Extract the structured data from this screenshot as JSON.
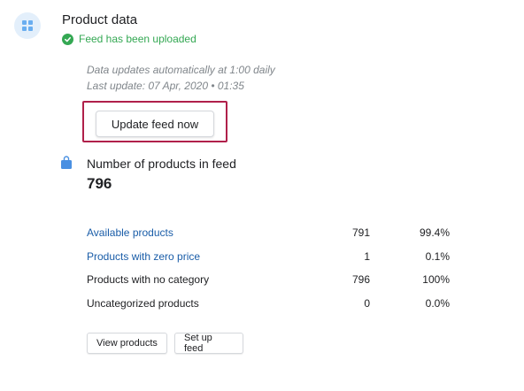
{
  "header": {
    "title": "Product data",
    "status": "Feed has been uploaded"
  },
  "schedule": {
    "auto_update": "Data updates automatically at 1:00 daily",
    "last_update": "Last update: 07 Apr, 2020 • 01:35"
  },
  "actions": {
    "update_feed": "Update feed now",
    "view_products": "View products",
    "set_up_feed": "Set up feed"
  },
  "summary": {
    "label": "Number of products in feed",
    "count": "796"
  },
  "stats": [
    {
      "label": "Available products",
      "count": "791",
      "percent": "99.4%",
      "link": true
    },
    {
      "label": "Products with zero price",
      "count": "1",
      "percent": "0.1%",
      "link": true
    },
    {
      "label": "Products with no category",
      "count": "796",
      "percent": "100%",
      "link": false
    },
    {
      "label": "Uncategorized products",
      "count": "0",
      "percent": "0.0%",
      "link": false
    }
  ],
  "colors": {
    "success": "#34a853",
    "link": "#1a5da8",
    "highlight": "#b0204a",
    "icon_bg": "#e3effb",
    "icon": "#4a90e2"
  },
  "icons": {
    "app": "grid-icon",
    "status": "check-circle-icon",
    "summary": "shopping-bag-icon"
  }
}
